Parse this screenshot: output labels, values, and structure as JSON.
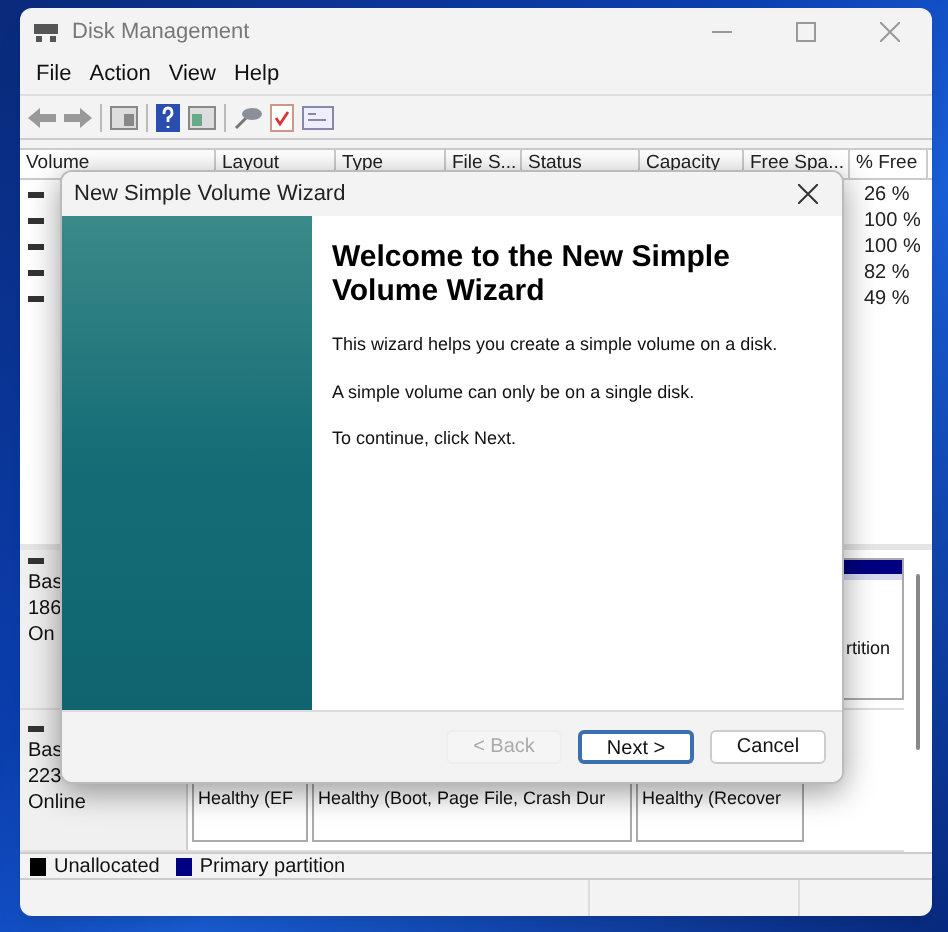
{
  "window": {
    "title": "Disk Management"
  },
  "menu": [
    "File",
    "Action",
    "View",
    "Help"
  ],
  "volume_table": {
    "columns": [
      "Volume",
      "Layout",
      "Type",
      "File S...",
      "Status",
      "Capacity",
      "Free Spa...",
      "% Free"
    ],
    "rows": [
      {
        "percent_free": "26 %"
      },
      {
        "percent_free": "100 %"
      },
      {
        "percent_free": "100 %"
      },
      {
        "percent_free": "82 %"
      },
      {
        "percent_free": "49 %"
      }
    ]
  },
  "disks": [
    {
      "labels": [
        "Bas",
        "186",
        "On"
      ],
      "partitions": [
        {
          "status": "rtition"
        }
      ]
    },
    {
      "labels": [
        "Bas",
        "223",
        "Online"
      ],
      "partitions": [
        {
          "status": "Healthy (EF"
        },
        {
          "status": "Healthy (Boot, Page File, Crash Dur"
        },
        {
          "status": "Healthy (Recover"
        }
      ]
    }
  ],
  "legend": [
    {
      "label": "Unallocated",
      "color": "#000000"
    },
    {
      "label": "Primary partition",
      "color": "#000080"
    }
  ],
  "dialog": {
    "title": "New Simple Volume Wizard",
    "heading": "Welcome to the New Simple Volume Wizard",
    "paragraphs": [
      "This wizard helps you create a simple volume on a disk.",
      "A simple volume can only be on a single disk.",
      "To continue, click Next."
    ],
    "buttons": [
      {
        "label": "< Back",
        "disabled": true,
        "default": false
      },
      {
        "label": "Next >",
        "disabled": false,
        "default": true
      },
      {
        "label": "Cancel",
        "disabled": false,
        "default": false
      }
    ]
  }
}
